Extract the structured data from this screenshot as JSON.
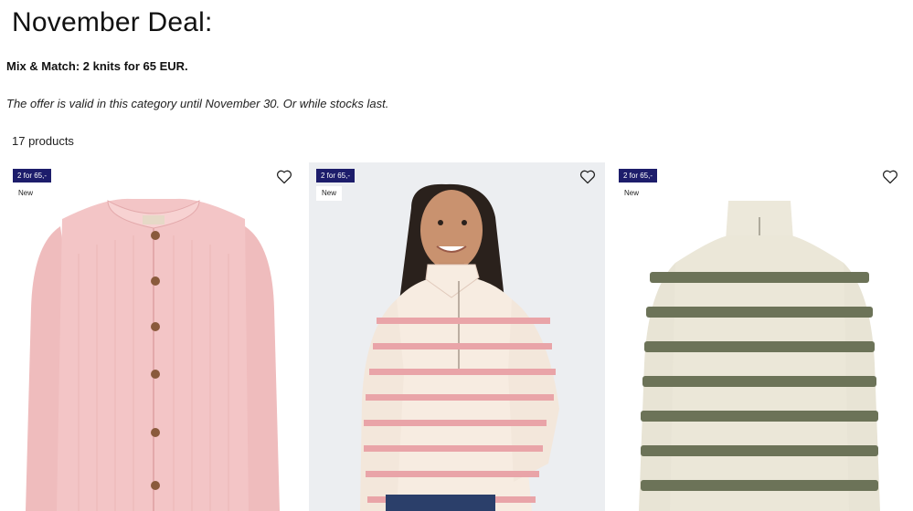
{
  "header": {
    "title": "November Deal:",
    "promo": "Mix & Match: 2 knits for 65 EUR.",
    "note": "The offer is valid in this category until November 30. Or while stocks last.",
    "count": "17 products"
  },
  "products": [
    {
      "deal_badge": "2 for 65,-",
      "new_badge": "New",
      "favorite_icon": "heart-outline-icon",
      "image": "pink-knit-cardigan",
      "colors": {
        "garment": "#f2c2c3",
        "bg": "#ffffff"
      }
    },
    {
      "deal_badge": "2 for 65,-",
      "new_badge": "New",
      "favorite_icon": "heart-outline-icon",
      "image": "model-in-pink-striped-half-zip-sweater",
      "colors": {
        "garment": "#f7ece1",
        "stripe": "#e9a4a8",
        "bg": "#eceef1"
      }
    },
    {
      "deal_badge": "2 for 65,-",
      "new_badge": "New",
      "favorite_icon": "heart-outline-icon",
      "image": "olive-striped-half-zip-sweater",
      "colors": {
        "garment": "#ebe7d8",
        "stripe": "#6c7358",
        "bg": "#ffffff"
      }
    }
  ]
}
